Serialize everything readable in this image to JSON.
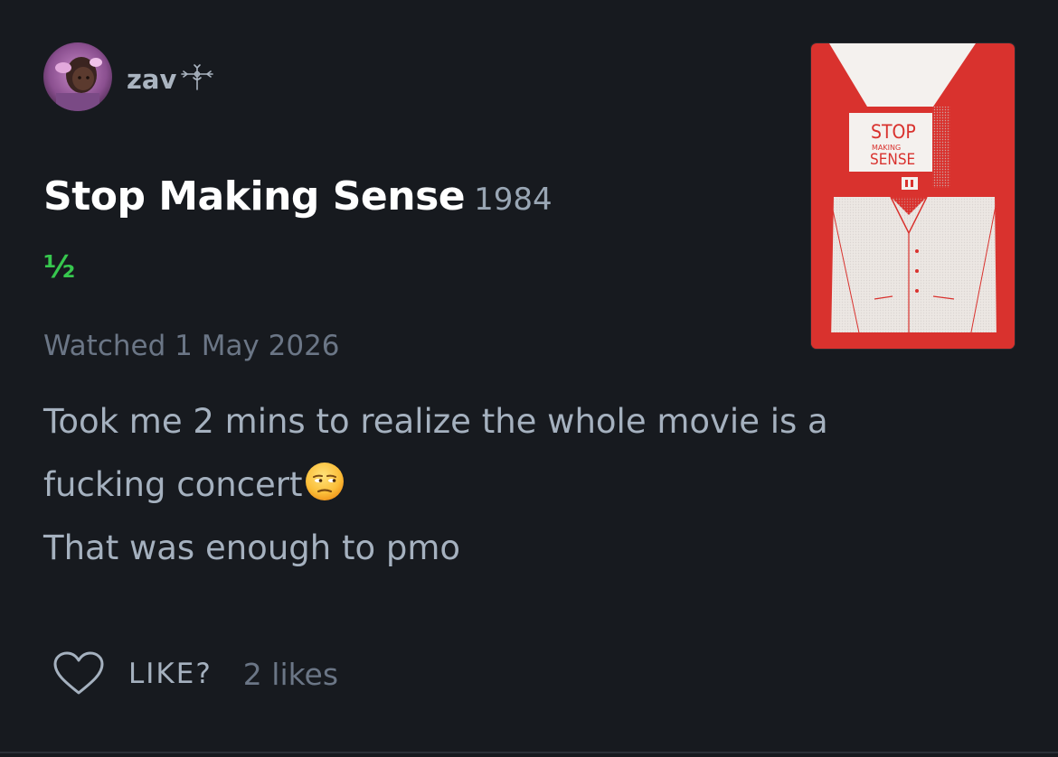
{
  "author": {
    "username": "zav",
    "username_glyph": "⚔",
    "avatar_icon": "user-avatar"
  },
  "film": {
    "title": "Stop Making Sense",
    "year": "1984",
    "rating": "½",
    "poster": {
      "title_line1": "STOP",
      "title_line2": "MAKING",
      "title_line3": "SENSE",
      "background_color": "#d9322e"
    }
  },
  "review": {
    "watched": "Watched 1 May 2026",
    "lines": [
      "Took me 2 mins to realize the whole movie is a",
      "fucking concert",
      "That was enough to pmo"
    ],
    "emoji": "unamused-face"
  },
  "actions": {
    "like_label": "LIKE?",
    "like_count": "2 likes",
    "like_icon": "heart-icon"
  },
  "colors": {
    "background": "#171a1f",
    "rating_green": "#37c74e",
    "text_primary": "#ffffff",
    "text_secondary": "#a5b1bf",
    "text_muted": "#6b7686"
  }
}
